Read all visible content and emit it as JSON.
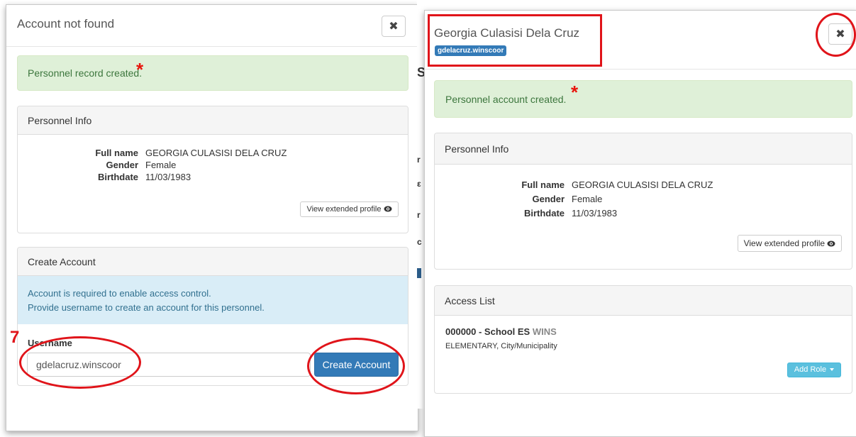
{
  "left_modal": {
    "title": "Account not found",
    "close_symbol": "✖",
    "alert": "Personnel record created.",
    "personnel_info": {
      "heading": "Personnel Info",
      "full_name_label": "Full name",
      "full_name": "GEORGIA CULASISI DELA CRUZ",
      "gender_label": "Gender",
      "gender": "Female",
      "birthdate_label": "Birthdate",
      "birthdate": "11/03/1983",
      "view_profile": "View extended profile"
    },
    "create_account": {
      "heading": "Create Account",
      "info_line1": "Account is required to enable access control.",
      "info_line2": "Provide username to create an account for this personnel.",
      "username_label": "Username",
      "username_value": "gdelacruz.winscoor",
      "button": "Create Account"
    }
  },
  "right_modal": {
    "title": "Georgia Culasisi Dela Cruz",
    "username_badge": "gdelacruz.winscoor",
    "close_symbol": "✖",
    "alert": "Personnel account created.",
    "personnel_info": {
      "heading": "Personnel Info",
      "full_name_label": "Full name",
      "full_name": "GEORGIA CULASISI DELA CRUZ",
      "gender_label": "Gender",
      "gender": "Female",
      "birthdate_label": "Birthdate",
      "birthdate": "11/03/1983",
      "view_profile": "View extended profile"
    },
    "access_list": {
      "heading": "Access List",
      "school_code_name": "000000 - School ES",
      "school_tag": "WINS",
      "school_desc": "ELEMENTARY, City/Municipality",
      "add_role": "Add Role"
    }
  },
  "annotations": {
    "star": "*",
    "step_number": "7",
    "color": "#e0141a"
  },
  "colors": {
    "primary": "#337ab7",
    "info": "#5bc0de",
    "success_bg": "#dff0d8",
    "success_text": "#3c763d",
    "info_bg": "#d9edf7"
  },
  "icons": {
    "close": "close-icon",
    "view": "eye-icon",
    "dropdown": "caret-down-icon"
  }
}
